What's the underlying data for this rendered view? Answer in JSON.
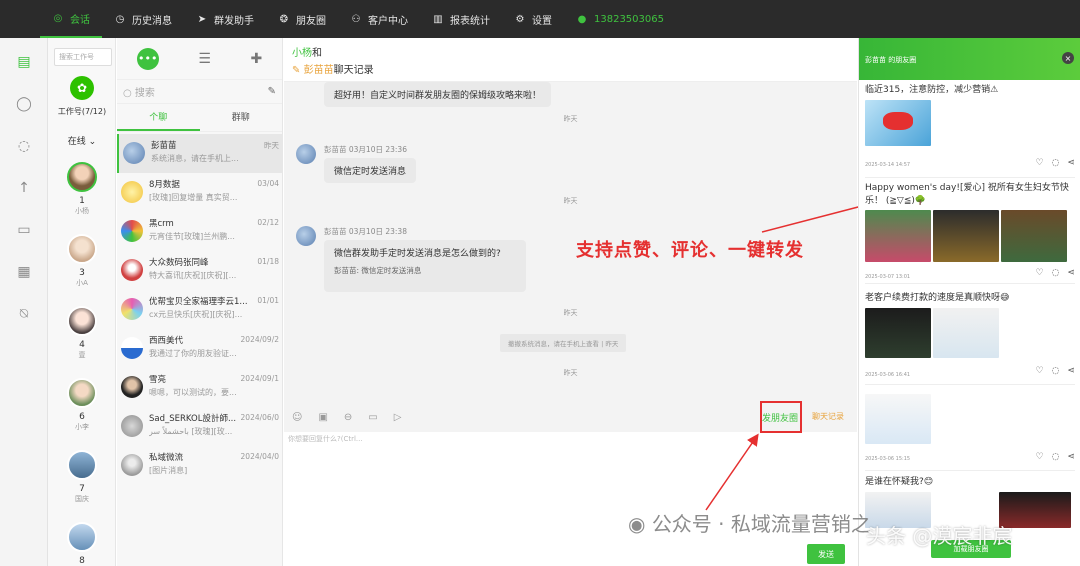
{
  "nav": [
    {
      "label": "会话",
      "icon": "chat-icon",
      "active": true
    },
    {
      "label": "历史消息",
      "icon": "clock-icon"
    },
    {
      "label": "群发助手",
      "icon": "send-icon"
    },
    {
      "label": "朋友圈",
      "icon": "moments-icon"
    },
    {
      "label": "客户中心",
      "icon": "user-icon"
    },
    {
      "label": "报表统计",
      "icon": "chart-icon"
    },
    {
      "label": "设置",
      "icon": "gear-icon"
    }
  ],
  "phone": "13823503065",
  "accounts": {
    "search_placeholder": "搜索工作号",
    "count_label": "工作号(7/12)",
    "online_label": "在线",
    "list": [
      {
        "count": "1",
        "name": "小杨"
      },
      {
        "count": "3",
        "name": "小A"
      },
      {
        "count": "4",
        "name": "壹"
      },
      {
        "count": "6",
        "name": "小李"
      },
      {
        "count": "7",
        "name": "国庆"
      },
      {
        "count": "8",
        "name": ""
      }
    ]
  },
  "conv": {
    "search_placeholder": "搜索",
    "seg_personal": "个聊",
    "seg_group": "群聊",
    "items": [
      {
        "name": "彭苗苗",
        "preview": "系统消息，请在手机上...",
        "time": "昨天"
      },
      {
        "name": "8月数据",
        "preview": "[玫瑰]回复增量 真实贸...",
        "time": "03/04"
      },
      {
        "name": "黑crm",
        "preview": "元宵佳节[玫瑰]兰州鹏...",
        "time": "02/12"
      },
      {
        "name": "大众数码张同峰",
        "preview": "特大喜讯[庆祝][庆祝][...",
        "time": "01/18"
      },
      {
        "name": "优帮宝贝全家福理李云1...",
        "preview": "cx元旦快乐[庆祝][庆祝]...",
        "time": "01/01"
      },
      {
        "name": "西西美代",
        "preview": "我通过了你的朋友验证...",
        "time": "2024/09/2"
      },
      {
        "name": "雪亮",
        "preview": "嗯嗯，可以测试的，要...",
        "time": "2024/09/1"
      },
      {
        "name": "Sad_SERKOL設計師...",
        "preview": "باحشملاً سر [玫瑰][玫...",
        "time": "2024/06/0"
      },
      {
        "name": "私域微流",
        "preview": "[图片消息]",
        "time": "2024/04/0"
      }
    ]
  },
  "chat": {
    "title_green": "小杨",
    "title_rest": "和",
    "subtitle_name": "彭苗苗",
    "subtitle_rest": "聊天记录",
    "first_bubble": "超好用！自定义时间群发朋友圈的保姆级攻略来啦！",
    "ts1": "昨天",
    "msg1_meta": "彭苗苗  03月10日 23:36",
    "msg1_text": "微信定时发送消息",
    "ts2": "昨天",
    "msg2_meta": "彭苗苗  03月10日 23:38",
    "msg2_text": "微信群发助手定时发送消息是怎么做到的?",
    "msg2_quote": "彭苗苗:  微信定时发送消息",
    "ts3": "昨天",
    "sys_msg": "撤撤系统消息，请在手机上查看 | 昨天",
    "ts4": "昨天",
    "moments_link": "发朋友圈",
    "chat_record": "聊天记录",
    "input_placeholder": "你想要回复什么?(Ctrl...",
    "send": "发送"
  },
  "annotation": "支持点赞、评论、一键转发",
  "moments": {
    "header": "彭苗苗 的朋友圈",
    "posts": [
      {
        "text": "临近315，注意防控，减少营销⚠",
        "date": "2025-03-14 14:57"
      },
      {
        "text": "Happy women's day![爱心] 祝所有女生妇女节快乐！ (≧▽≦)🌳",
        "date": "2025-03-07 13:01"
      },
      {
        "text": "老客户续费打款的速度是真顺快呀😅",
        "date": "2025-03-06 16:41"
      },
      {
        "text": "",
        "date": "2025-03-06 15:15"
      },
      {
        "text": "是谁在怀疑我?😊",
        "date": ""
      }
    ],
    "bottom_btn": "加载朋友圈"
  },
  "watermark_left": "公众号 · 私域流量营销之",
  "watermark_right": "头条 @漠宸非宸",
  "colors": {
    "accent": "#3fc23f",
    "annotation": "#e53030",
    "topbar": "#2b2b2b"
  }
}
